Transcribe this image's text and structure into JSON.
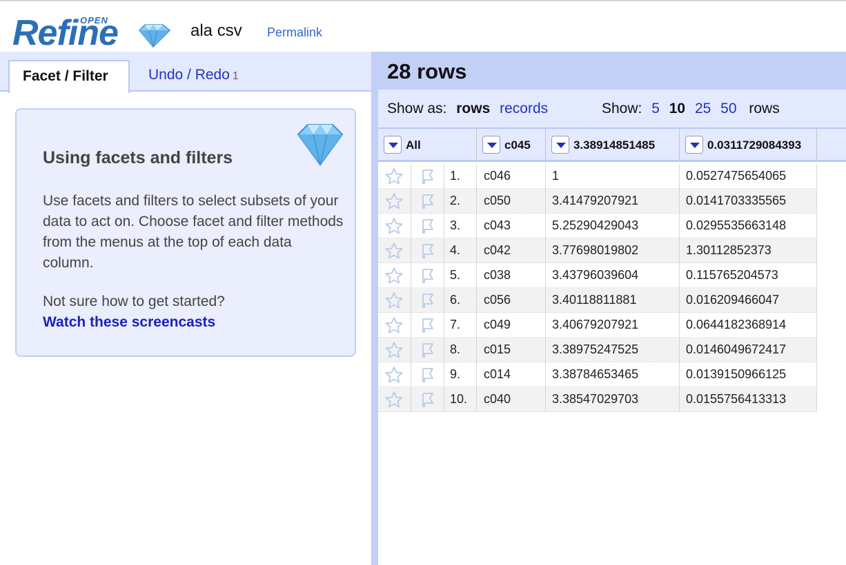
{
  "header": {
    "logo_text": "Refine",
    "logo_super": "OPEN",
    "project_name": "ala csv",
    "permalink": "Permalink"
  },
  "left_panel": {
    "tabs": {
      "facet_filter": "Facet / Filter",
      "undo_redo": "Undo / Redo",
      "undo_count": "1"
    },
    "help": {
      "title": "Using facets and filters",
      "body": "Use facets and filters to select subsets of your data to act on. Choose facet and filter methods from the menus at the top of each data column.",
      "question": "Not sure how to get started?",
      "link": "Watch these screencasts"
    }
  },
  "summary": {
    "row_count": "28 rows"
  },
  "view_bar": {
    "show_as_label": "Show as:",
    "rows_option": "rows",
    "records_option": "records",
    "show_label": "Show:",
    "page_sizes": [
      "5",
      "10",
      "25",
      "50"
    ],
    "selected_page_size": "10",
    "rows_suffix": "rows"
  },
  "table": {
    "columns": [
      "All",
      "c045",
      "3.38914851485",
      "0.0311729084393"
    ],
    "rows": [
      {
        "index": "1.",
        "a": "c046",
        "b": "1",
        "c": "0.0527475654065"
      },
      {
        "index": "2.",
        "a": "c050",
        "b": "3.41479207921",
        "c": "0.0141703335565"
      },
      {
        "index": "3.",
        "a": "c043",
        "b": "5.25290429043",
        "c": "0.0295535663148"
      },
      {
        "index": "4.",
        "a": "c042",
        "b": "3.77698019802",
        "c": "1.30112852373"
      },
      {
        "index": "5.",
        "a": "c038",
        "b": "3.43796039604",
        "c": "0.115765204573"
      },
      {
        "index": "6.",
        "a": "c056",
        "b": "3.40118811881",
        "c": "0.016209466047"
      },
      {
        "index": "7.",
        "a": "c049",
        "b": "3.40679207921",
        "c": "0.0644182368914"
      },
      {
        "index": "8.",
        "a": "c015",
        "b": "3.38975247525",
        "c": "0.0146049672417"
      },
      {
        "index": "9.",
        "a": "c014",
        "b": "3.38784653465",
        "c": "0.0139150966125"
      },
      {
        "index": "10.",
        "a": "c040",
        "b": "3.38547029703",
        "c": "0.0155756413313"
      }
    ],
    "row_icons": [
      "star-icon",
      "flag-icon"
    ]
  },
  "colors": {
    "accent_blue": "#2233bb",
    "header_band": "#c2d0f7",
    "panel_band": "#e3e9ff",
    "logo_blue": "#2c6fb7"
  }
}
